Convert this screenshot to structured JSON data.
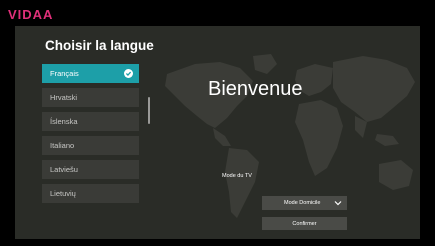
{
  "brand": {
    "logo_text": "VIDAA",
    "accent_color": "#e0307a"
  },
  "page": {
    "title": "Choisir la langue",
    "welcome": "Bienvenue"
  },
  "languages": [
    {
      "label": "Français",
      "selected": true
    },
    {
      "label": "Hrvatski",
      "selected": false
    },
    {
      "label": "Íslenska",
      "selected": false
    },
    {
      "label": "Italiano",
      "selected": false
    },
    {
      "label": "Latviešu",
      "selected": false
    },
    {
      "label": "Lietuvių",
      "selected": false
    }
  ],
  "tv_mode": {
    "label": "Mode du TV",
    "value": "Mode Domicile"
  },
  "confirm_label": "Confirmer",
  "colors": {
    "selected": "#1d9fa8",
    "panel": "#2a2c27",
    "item": "#3a3b37"
  }
}
